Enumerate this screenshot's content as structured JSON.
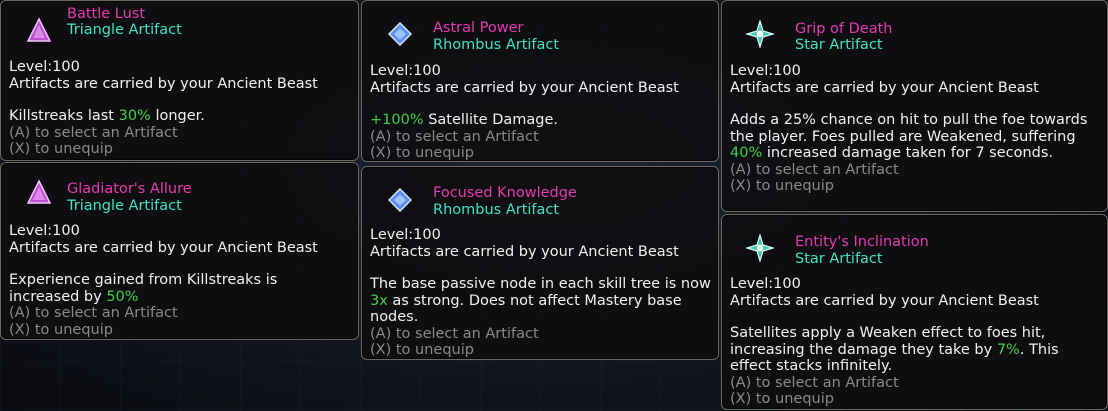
{
  "common": {
    "level_text": "Level:100",
    "carried_text": "Artifacts are carried by your Ancient Beast",
    "select_hint": "(A) to select an Artifact",
    "unequip_hint": "(X) to unequip"
  },
  "colors": {
    "name": "#e63ab2",
    "type": "#3fe3c4",
    "highlight": "#3ed04a",
    "hint": "#8a8a8a"
  },
  "cards": [
    {
      "name": "Battle Lust",
      "type": "Triangle Artifact",
      "icon": "triangle-gem-icon",
      "desc": {
        "pre": "Killstreaks last ",
        "hl": "30%",
        "post": " longer."
      }
    },
    {
      "name": "Astral Power",
      "type": "Rhombus Artifact",
      "icon": "rhombus-gem-icon",
      "desc": {
        "pre": "",
        "hl": "+100%",
        "post": " Satellite Damage."
      }
    },
    {
      "name": "Grip of Death",
      "type": "Star Artifact",
      "icon": "star-gem-icon",
      "desc": {
        "pre": "Adds a 25% chance on hit to pull the foe towards the player. Foes pulled are Weakened, suffering ",
        "hl": "40%",
        "post": " increased damage taken for 7 seconds."
      }
    },
    {
      "name": "Gladiator's Allure",
      "type": "Triangle Artifact",
      "icon": "triangle-gem-icon",
      "desc": {
        "pre": "Experience gained from Killstreaks is increased by ",
        "hl": "50%",
        "post": ""
      }
    },
    {
      "name": "Focused Knowledge",
      "type": "Rhombus Artifact",
      "icon": "rhombus-gem-icon",
      "desc": {
        "pre": "The base passive node in each skill tree is now ",
        "hl": "3x",
        "post": " as strong. Does not affect Mastery base nodes."
      }
    },
    {
      "name": "Entity's Inclination",
      "type": "Star Artifact",
      "icon": "star-gem-icon",
      "desc": {
        "pre": "Satellites apply a Weaken effect to foes hit, increasing the damage they take by ",
        "hl": "7%",
        "post": ". This effect stacks infinitely."
      }
    }
  ]
}
